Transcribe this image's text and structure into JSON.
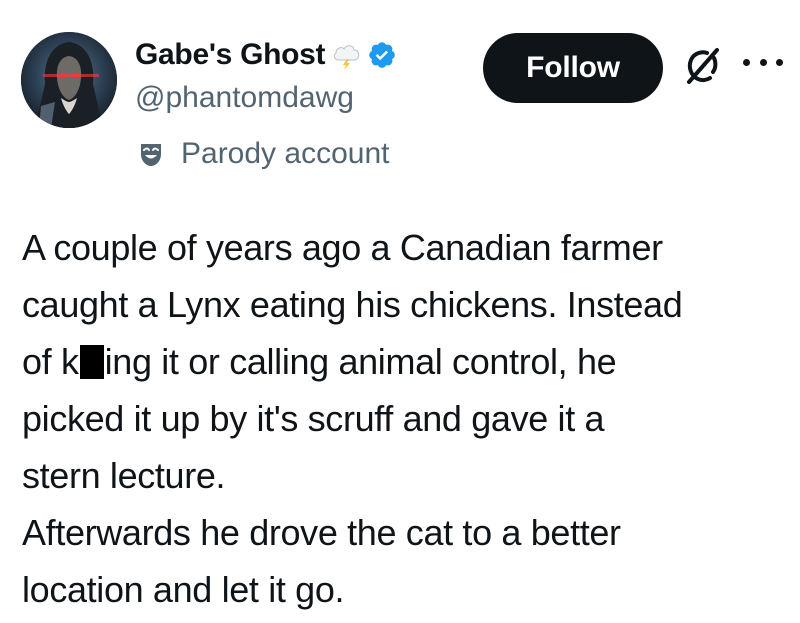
{
  "user": {
    "display_name": "Gabe's Ghost",
    "handle": "@phantomdawg",
    "label": "Parody account",
    "avatar_icon": "avatar-hooded-figure",
    "name_emoji_icon": "cloud-lightning-icon",
    "verified_icon": "verified-badge-icon",
    "verified_color": "#1d9bf0"
  },
  "actions": {
    "follow_label": "Follow",
    "grok_icon": "grok-icon",
    "more_icon": "more-options-icon"
  },
  "tweet": {
    "line1": "A couple of years ago a Canadian farmer",
    "line2": "caught a Lynx eating his chickens. Instead",
    "line3_before": "of k",
    "line3_after": "ing it or calling animal control, he",
    "line4": "picked it up by it's scruff and gave it a",
    "line5": "stern lecture.",
    "line6": "Afterwards he drove the cat to a better",
    "line7": "location and let it go."
  }
}
